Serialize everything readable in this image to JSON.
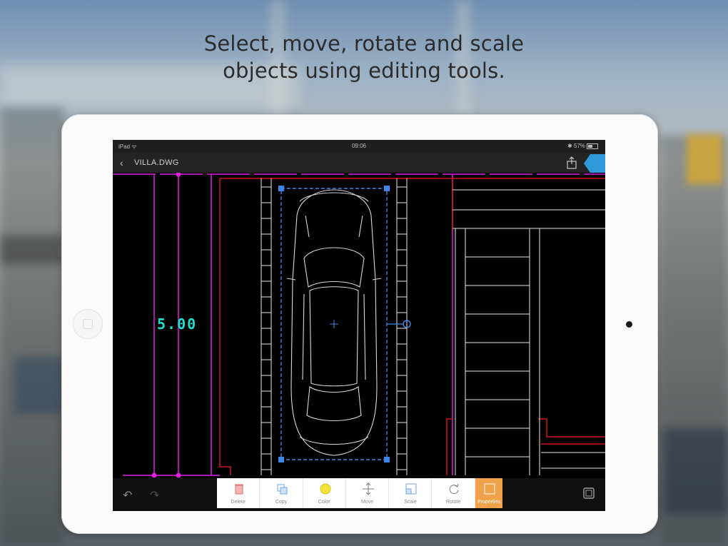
{
  "headline": {
    "line1": "Select, move, rotate and scale",
    "line2": "objects using editing tools."
  },
  "statusbar": {
    "left": "iPad ᯤ",
    "time": "09:06",
    "right": "✱ 57%"
  },
  "navbar": {
    "back_icon": "chevron-left-icon",
    "title": "VILLA.DWG"
  },
  "drawing": {
    "dimension": "5.00"
  },
  "toolbar": {
    "tools": [
      {
        "label": "Delete",
        "icon": "trash-icon"
      },
      {
        "label": "Copy",
        "icon": "copy-icon"
      },
      {
        "label": "Color",
        "icon": "color-icon"
      },
      {
        "label": "Move",
        "icon": "move-icon"
      },
      {
        "label": "Scale",
        "icon": "scale-icon"
      },
      {
        "label": "Rotate",
        "icon": "rotate-icon"
      },
      {
        "label": "Properties",
        "icon": "properties-icon"
      }
    ]
  },
  "colors": {
    "accent_blue": "#2e9ad9",
    "active_tool": "#f0a24a",
    "dimension_text": "#19e0d0",
    "magenta_lines": "#e020e0",
    "red_lines": "#d0141e",
    "selection_blue": "#3d86e6"
  }
}
